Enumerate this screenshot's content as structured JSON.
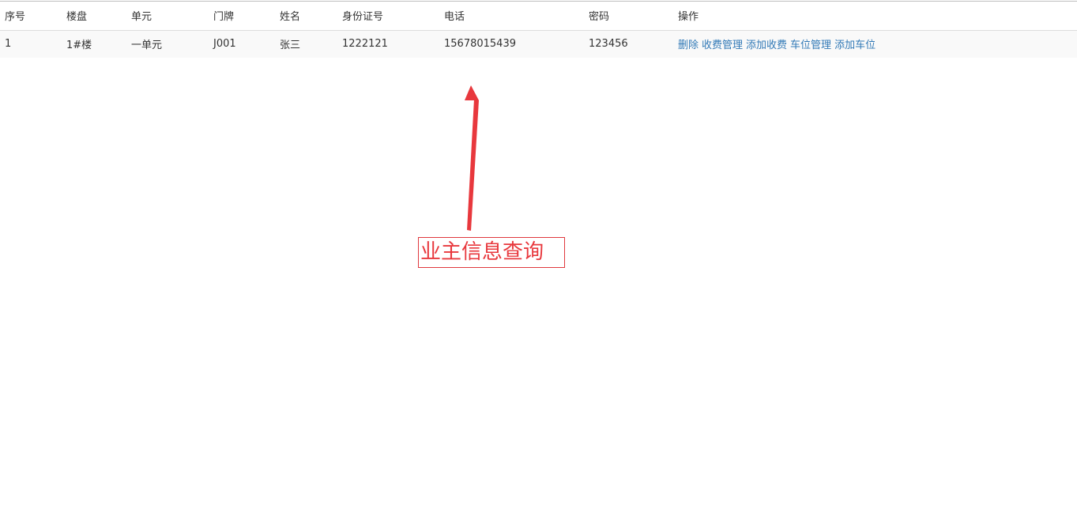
{
  "table": {
    "headers": {
      "index": "序号",
      "building": "楼盘",
      "unit": "单元",
      "door": "门牌",
      "name": "姓名",
      "id_number": "身份证号",
      "phone": "电话",
      "password": "密码",
      "actions": "操作"
    },
    "rows": [
      {
        "index": "1",
        "building": "1#楼",
        "unit": "一单元",
        "door": "J001",
        "name": "张三",
        "id_number": "1222121",
        "phone": "15678015439",
        "password": "123456",
        "actions": {
          "delete": "删除",
          "fee_manage": "收费管理",
          "add_fee": "添加收费",
          "parking_manage": "车位管理",
          "add_parking": "添加车位"
        }
      }
    ]
  },
  "annotation": {
    "label": "业主信息查询",
    "color": "#e8383d"
  },
  "colors": {
    "link": "#337ab7",
    "row_stripe": "#f9f9f9",
    "border": "#dddddd"
  }
}
